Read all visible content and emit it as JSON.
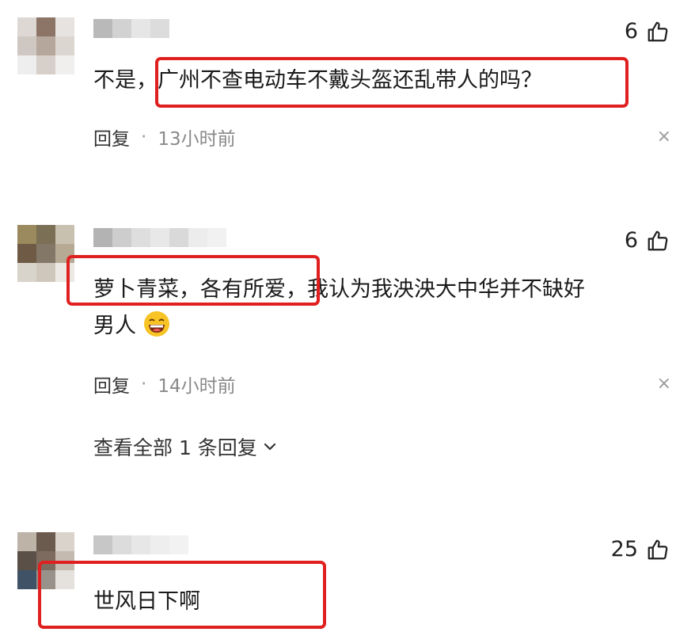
{
  "comments": [
    {
      "likes": "6",
      "text_pre": "不是，",
      "text_highlight": "广州不查电动车不戴头盔还乱带人的吗？",
      "reply_label": "回复",
      "separator": "·",
      "time": "13小时前",
      "close_glyph": "×"
    },
    {
      "likes": "6",
      "text_highlight": "萝卜青菜，各有所爱",
      "text_rest": "，我认为我泱泱大中华并不缺好",
      "text_line2": "男人",
      "emoji": "grinning-face-emoji",
      "reply_label": "回复",
      "separator": "·",
      "time": "14小时前",
      "close_glyph": "×",
      "view_replies": "查看全部 1 条回复"
    },
    {
      "likes": "25",
      "text_highlight": "世风日下啊"
    }
  ],
  "colors": {
    "highlight_border": "#e02020",
    "time_text": "#8a8a8a",
    "thumb_icon": "#222222"
  },
  "icons": [
    "thumbs-up-icon",
    "close-icon",
    "chevron-down-icon"
  ]
}
